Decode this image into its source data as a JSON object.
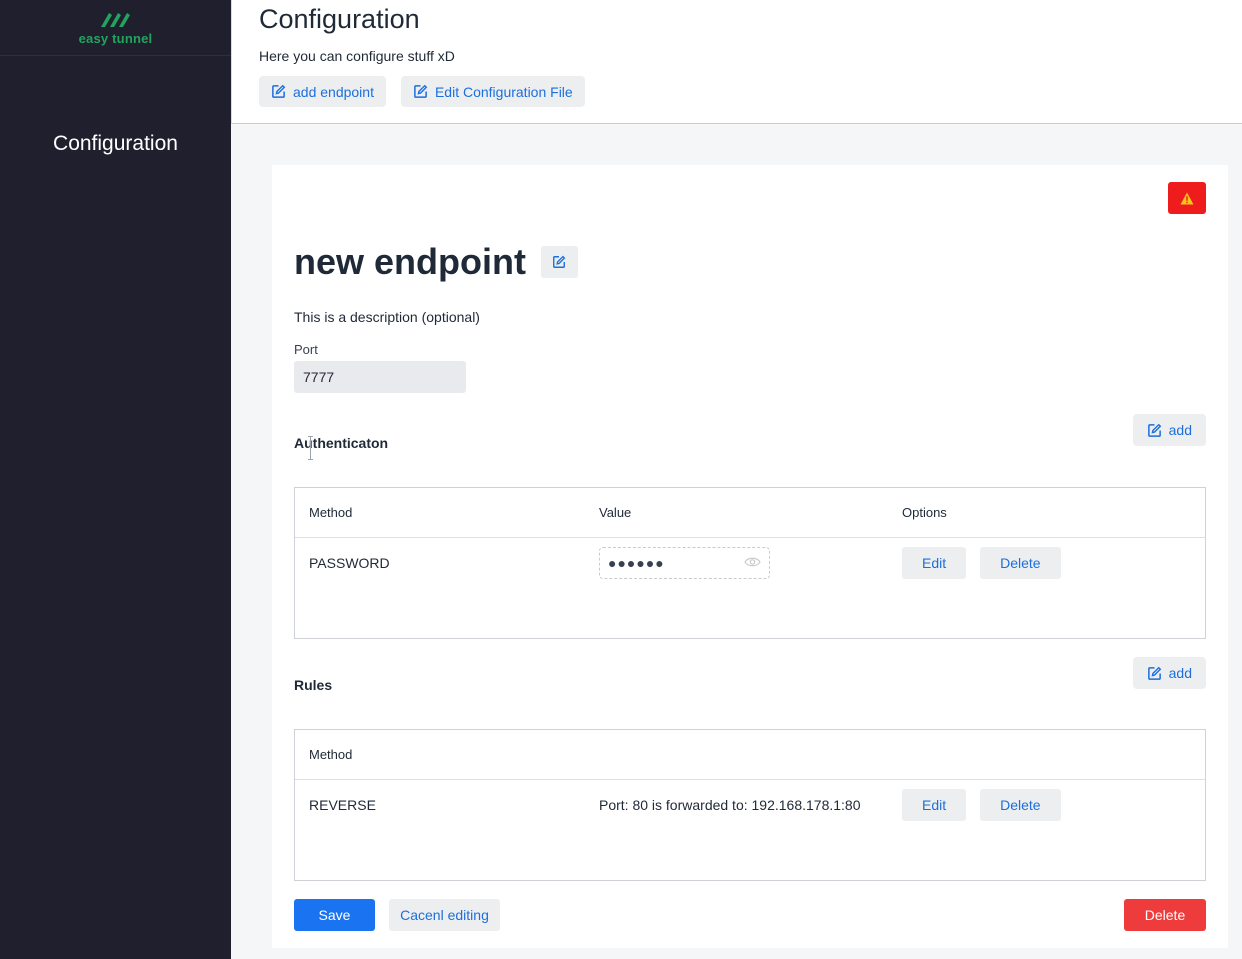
{
  "app": {
    "logo_text": "easy tunnel",
    "accent": "#22a45d"
  },
  "sidebar": {
    "items": [
      {
        "label": "Configuration"
      }
    ]
  },
  "header": {
    "title": "Configuration",
    "subtitle": "Here you can configure stuff xD",
    "buttons": {
      "add_endpoint": "add endpoint",
      "edit_config_file": "Edit Configuration File"
    }
  },
  "endpoint": {
    "name": "new endpoint",
    "description": "This is a description (optional)",
    "port_label": "Port",
    "port_value": "7777"
  },
  "auth": {
    "title": "Authenticaton",
    "add_label": "add",
    "columns": [
      "Method",
      "Value",
      "Options"
    ],
    "rows": [
      {
        "method": "PASSWORD",
        "value_masked": "●●●●●●"
      }
    ],
    "edit_label": "Edit",
    "delete_label": "Delete"
  },
  "rules": {
    "title": "Rules",
    "add_label": "add",
    "columns": [
      "Method"
    ],
    "rows": [
      {
        "method": "REVERSE",
        "detail": "Port: 80 is forwarded to: 192.168.178.1:80"
      }
    ],
    "edit_label": "Edit",
    "delete_label": "Delete"
  },
  "footer": {
    "save": "Save",
    "cancel": "Cacenl editing",
    "delete": "Delete"
  },
  "colors": {
    "sidebar_bg": "#1f1f2e",
    "primary": "#1a73f0",
    "danger": "#ee3b3b",
    "warning_bg": "#ee1c1c",
    "link": "#1c6fdc"
  }
}
